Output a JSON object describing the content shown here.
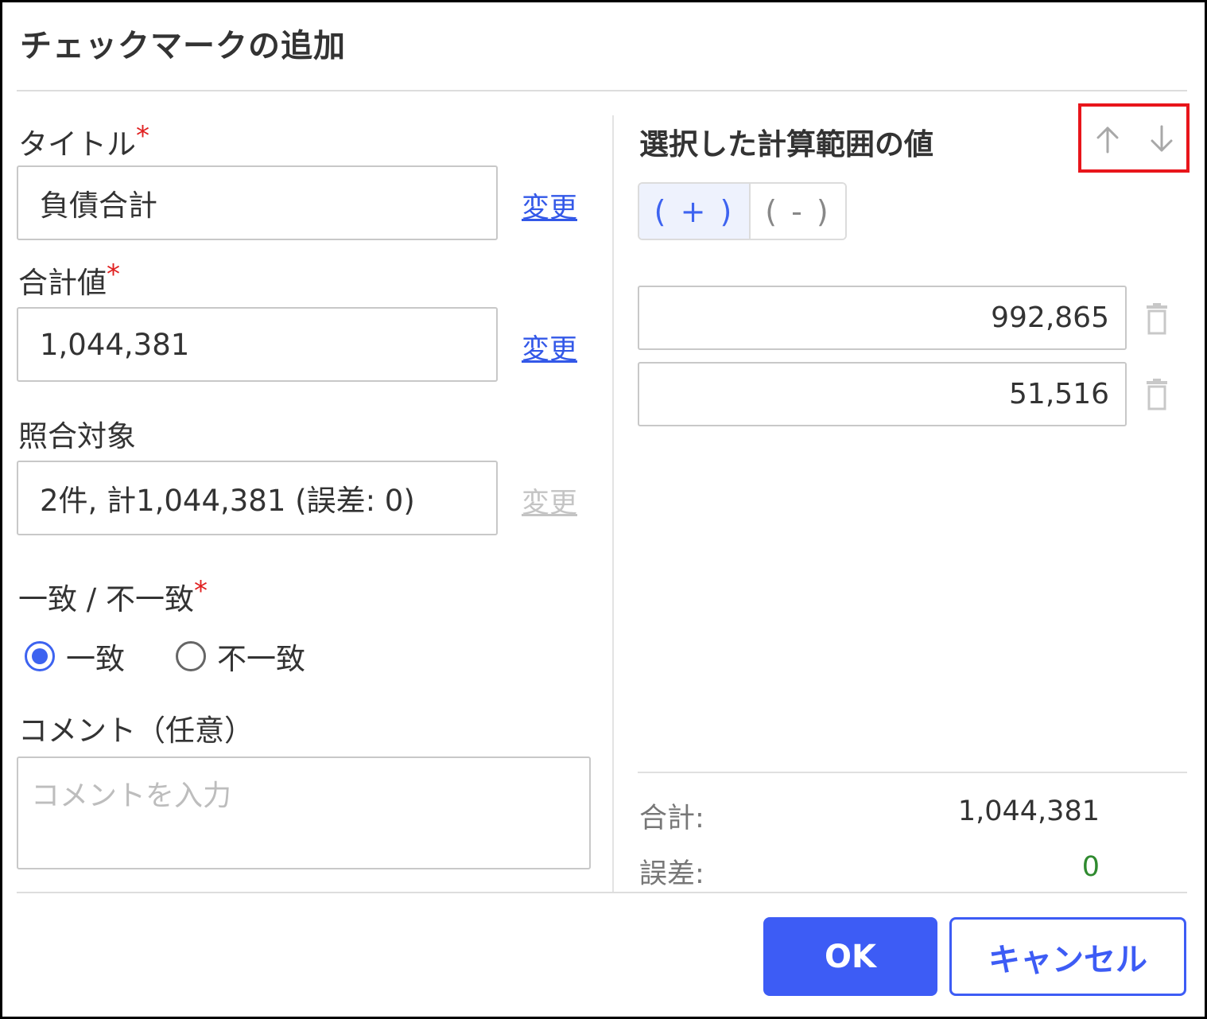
{
  "dialog": {
    "title": "チェックマークの追加"
  },
  "form": {
    "title_label": "タイトル",
    "title_value": "負債合計",
    "title_change": "変更",
    "total_label": "合計値",
    "total_value": "1,044,381",
    "total_change": "変更",
    "target_label": "照合対象",
    "target_value": "2件, 計1,044,381 (誤差: 0)",
    "target_change": "変更",
    "match_label": "一致 / 不一致",
    "match_option": "一致",
    "mismatch_option": "不一致",
    "selected_option": "一致",
    "comment_label": "コメント（任意）",
    "comment_placeholder": "コメントを入力",
    "required_mark": "*"
  },
  "range_panel": {
    "title": "選択した計算範囲の値",
    "sort_up_icon": "arrow-up-icon",
    "sort_down_icon": "arrow-down-icon",
    "plus_label": "( + )",
    "minus_label": "( - )",
    "active_sign": "plus",
    "values": [
      "992,865",
      "51,516"
    ],
    "delete_icon": "trash-icon",
    "sum_label": "合計:",
    "sum_value": "1,044,381",
    "diff_label": "誤差:",
    "diff_value": "0"
  },
  "footer": {
    "ok_label": "OK",
    "cancel_label": "キャンセル"
  },
  "colors": {
    "primary": "#3d5cf5",
    "required": "#e02020",
    "link": "#3358e8",
    "diff_ok": "#2f8a2f",
    "highlight_box": "#e8151b"
  }
}
